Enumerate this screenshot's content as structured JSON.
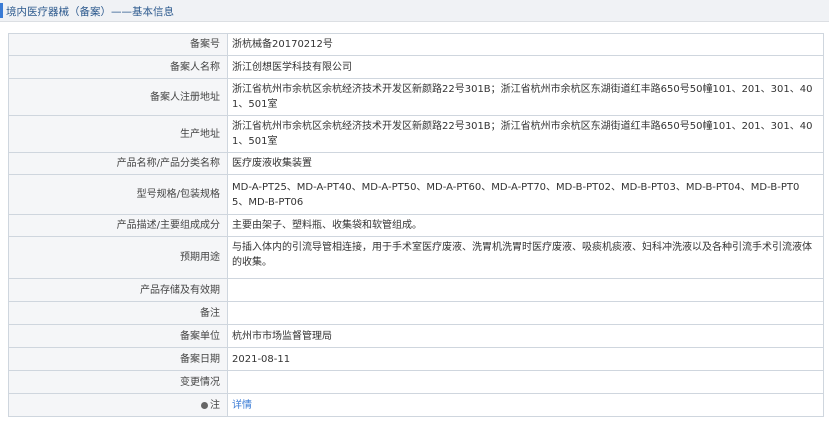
{
  "header": {
    "title": "境内医疗器械（备案）——基本信息"
  },
  "rows": [
    {
      "label": "备案号",
      "value": "浙杭械备20170212号"
    },
    {
      "label": "备案人名称",
      "value": "浙江创想医学科技有限公司"
    },
    {
      "label": "备案人注册地址",
      "value": "浙江省杭州市余杭区余杭经济技术开发区新颜路22号301B；浙江省杭州市余杭区东湖街道红丰路650号50幢101、201、301、401、501室"
    },
    {
      "label": "生产地址",
      "value": "浙江省杭州市余杭区余杭经济技术开发区新颜路22号301B；浙江省杭州市余杭区东湖街道红丰路650号50幢101、201、301、401、501室"
    },
    {
      "label": "产品名称/产品分类名称",
      "value": "医疗废液收集装置"
    },
    {
      "label": "型号规格/包装规格",
      "value": "MD-A-PT25、MD-A-PT40、MD-A-PT50、MD-A-PT60、MD-A-PT70、MD-B-PT02、MD-B-PT03、MD-B-PT04、MD-B-PT05、MD-B-PT06"
    },
    {
      "label": "产品描述/主要组成成分",
      "value": "主要由架子、塑料瓶、收集袋和软管组成。"
    },
    {
      "label": "预期用途",
      "value": "与插入体内的引流导管相连接，用于手术室医疗废液、洗胃机洗胃时医疗废液、吸痰机痰液、妇科冲洗液以及各种引流手术引流液体的收集。"
    },
    {
      "label": "产品存储及有效期",
      "value": ""
    },
    {
      "label": "备注",
      "value": ""
    },
    {
      "label": "备案单位",
      "value": "杭州市市场监督管理局"
    },
    {
      "label": "备案日期",
      "value": "2021-08-11"
    },
    {
      "label": "变更情况",
      "value": ""
    },
    {
      "label": "注",
      "value": "详情"
    }
  ]
}
